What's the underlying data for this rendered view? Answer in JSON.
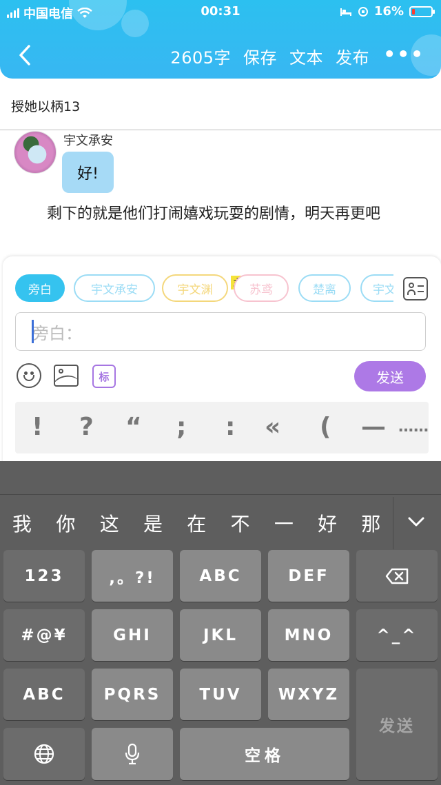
{
  "status_bar": {
    "carrier": "中国电信",
    "time": "00:31",
    "battery_percent": "16%",
    "battery_level": 0.16,
    "battery_color": "#ff3b30"
  },
  "nav": {
    "back_icon": "chevron-left-icon",
    "word_count": "2605字",
    "save_label": "保存",
    "text_label": "文本",
    "publish_label": "发布",
    "more_label": "•••"
  },
  "chapter": {
    "title": "授她以柄13"
  },
  "message": {
    "speaker": "宇文承安",
    "text": "好!"
  },
  "narration": "剩下的就是他们打闹嬉戏玩耍的剧情，明天再更吧",
  "compose": {
    "characters": [
      {
        "label": "旁白",
        "color": "#35c3ef",
        "active": true
      },
      {
        "label": "宇文承安",
        "color": "#9bdcf5",
        "active": false
      },
      {
        "label": "宇文渊",
        "color": "#f4d77b",
        "active": false
      },
      {
        "label": "苏鸢",
        "color": "#f7c3cf",
        "active": false
      },
      {
        "label": "楚离",
        "color": "#9bdcf5",
        "active": false
      },
      {
        "label": "宇文",
        "color": "#9bdcf5",
        "active": false
      }
    ],
    "main_badge": "主",
    "input_placeholder": "旁白：",
    "mark_label": "标",
    "send_label": "发送",
    "send_color": "#ad79e6",
    "punctuation": [
      "!",
      "?",
      "“",
      ";",
      ":",
      "«",
      "(",
      "—",
      "……"
    ]
  },
  "keyboard": {
    "candidates": [
      "我",
      "你",
      "这",
      "是",
      "在",
      "不",
      "一",
      "好",
      "那"
    ],
    "keys": {
      "num": "123",
      "punct": ",。?!",
      "abc": "ABC",
      "def": "DEF",
      "symbols": "#@¥",
      "ghi": "GHI",
      "jkl": "JKL",
      "mno": "MNO",
      "emoticon": "^_^",
      "abc_mode": "ABC",
      "pqrs": "PQRS",
      "tuv": "TUV",
      "wxyz": "WXYZ",
      "send": "发送",
      "space": "空格"
    }
  }
}
